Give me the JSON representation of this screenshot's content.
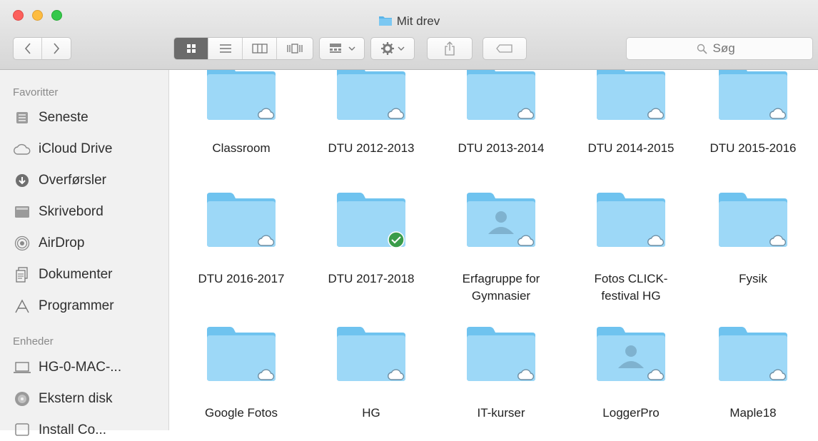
{
  "window": {
    "title": "Mit drev"
  },
  "toolbar": {
    "nav": {
      "back": "‹",
      "forward": "›"
    },
    "views": [
      "icon-view",
      "list-view",
      "column-view",
      "cover-flow-view"
    ],
    "search_placeholder": "Søg"
  },
  "sidebar": {
    "favorites_heading": "Favoritter",
    "favorites": [
      {
        "label": "Seneste",
        "icon": "recents-icon"
      },
      {
        "label": "iCloud Drive",
        "icon": "cloud-icon"
      },
      {
        "label": "Overførsler",
        "icon": "downloads-icon"
      },
      {
        "label": "Skrivebord",
        "icon": "desktop-icon"
      },
      {
        "label": "AirDrop",
        "icon": "airdrop-icon"
      },
      {
        "label": "Dokumenter",
        "icon": "documents-icon"
      },
      {
        "label": "Programmer",
        "icon": "applications-icon"
      }
    ],
    "devices_heading": "Enheder",
    "devices": [
      {
        "label": "HG-0-MAC-...",
        "icon": "laptop-icon"
      },
      {
        "label": "Ekstern disk",
        "icon": "disk-icon"
      },
      {
        "label": "Install Co...",
        "icon": "disk-icon"
      }
    ]
  },
  "folders": [
    {
      "name": "Classroom",
      "badge": "cloud"
    },
    {
      "name": "DTU 2012-2013",
      "badge": "cloud"
    },
    {
      "name": "DTU 2013-2014",
      "badge": "cloud"
    },
    {
      "name": "DTU 2014-2015",
      "badge": "cloud"
    },
    {
      "name": "DTU 2015-2016",
      "badge": "cloud"
    },
    {
      "name": "DTU 2016-2017",
      "badge": "cloud"
    },
    {
      "name": "DTU 2017-2018",
      "badge": "synced"
    },
    {
      "name": "Erfagruppe for Gymnasier",
      "line1": "Erfagruppe for",
      "line2": "Gymnasier",
      "badge": "cloud",
      "shared": true
    },
    {
      "name": "Fotos CLICK-festival HG",
      "line1": "Fotos CLICK-",
      "line2": "festival HG",
      "badge": "cloud"
    },
    {
      "name": "Fysik",
      "badge": "cloud"
    },
    {
      "name": "Google Fotos",
      "badge": "cloud"
    },
    {
      "name": "HG",
      "badge": "cloud"
    },
    {
      "name": "IT-kurser",
      "badge": "cloud"
    },
    {
      "name": "LoggerPro",
      "badge": "cloud",
      "shared": true
    },
    {
      "name": "Maple18",
      "badge": "cloud"
    }
  ],
  "colors": {
    "folder_back": "#6fc3ef",
    "folder_front": "#9dd8f7",
    "synced_badge": "#3a9c4a",
    "sidebar_bg": "#f1f1f1"
  }
}
